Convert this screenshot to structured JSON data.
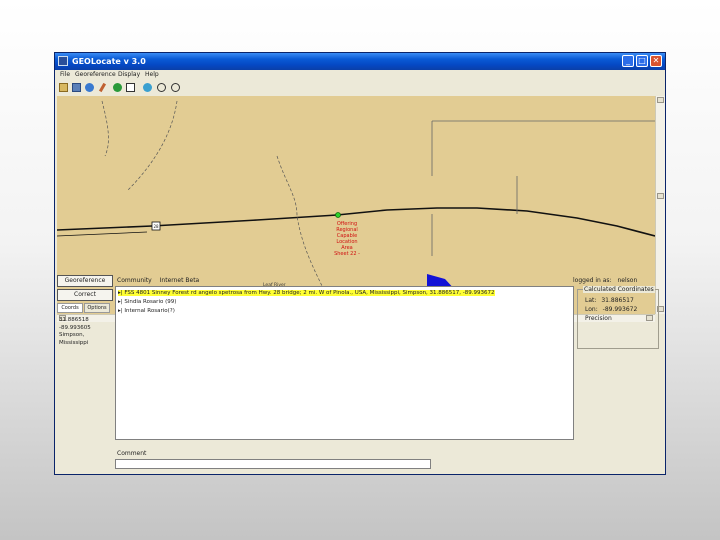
{
  "window": {
    "title": "GEOLocate v 3.0",
    "controls": [
      "_",
      "□",
      "✕"
    ]
  },
  "menu": [
    "File",
    "Georeference",
    "Display",
    "Help"
  ],
  "toolbar": {
    "icons": [
      "open-icon",
      "save-icon",
      "globe-icon",
      "pencil-icon",
      "earth-green-icon",
      "edit-icon",
      "world-icon",
      "zoom-in-icon",
      "zoom-out-icon"
    ]
  },
  "map": {
    "highway_shield": "28",
    "result_label": "Offering Regional Capable Location Area Sheet 22 -",
    "road_label": "Leaf River"
  },
  "left": {
    "georeference_button": "Georeference",
    "correct_button": "Correct",
    "tabs": [
      "Coords",
      "Options"
    ],
    "results": [
      "31.886518",
      "-89.993605",
      "Simpson,",
      "Mississippi"
    ]
  },
  "locality": {
    "header_left": "Community",
    "header_right": "Internet Beta",
    "items": [
      "▸| FSS 4801 Sinney Forest rd angelo spetrosa from Hwy. 28 bridge; 2 mi. W of Pinola., USA, Mississippi, Simpson, 31.886517, -89.993672",
      "▸| Sindia Rosario (99)",
      "▸| Internal Rosario(?)"
    ]
  },
  "comment": {
    "label": "Comment",
    "value": ""
  },
  "login": {
    "label": "logged in as:",
    "user": "nelson"
  },
  "coordinates": {
    "legend": "Calculated Coordinates",
    "lat_label": "Lat:",
    "lat": "31.886517",
    "lon_label": "Lon:",
    "lon": "-89.993672",
    "precision": "Precision"
  },
  "colors": {
    "map_background": "#e2cc93",
    "water_body": "#1212d6",
    "highlight": "#ffff33",
    "title_bar": "#0548c4"
  }
}
